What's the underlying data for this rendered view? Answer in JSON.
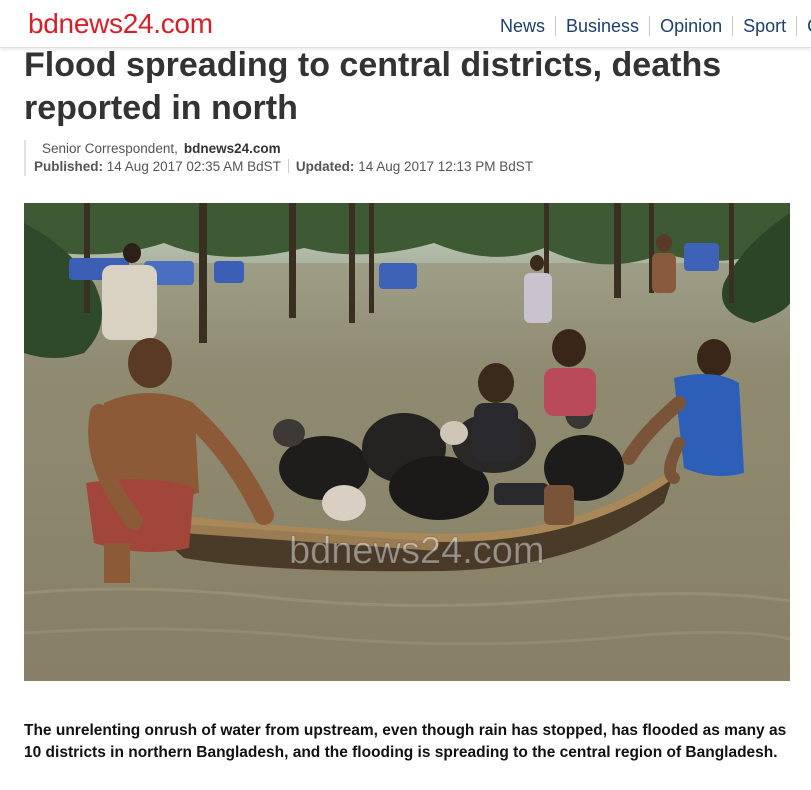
{
  "header": {
    "logo": "bdnews24.com",
    "nav": [
      "News",
      "Business",
      "Opinion",
      "Sport",
      "C"
    ]
  },
  "article": {
    "title": "Flood spreading to central districts, deaths reported in north",
    "author": "Senior Correspondent,",
    "author_site": "bdnews24.com",
    "published_label": "Published:",
    "published_value": "14 Aug 2017 02:35 AM BdST",
    "updated_label": "Updated:",
    "updated_value": "14 Aug 2017 12:13 PM BdST",
    "photo_watermark": "bdnews24.com",
    "lead": "The unrelenting onrush of water from upstream, even though rain has stopped, has flooded as many as 10 districts in northern Bangladesh, and the flooding is spreading to the central region of Bangladesh."
  },
  "colors": {
    "brand": "#d3202a",
    "nav_text": "#1d3f6b",
    "headline": "#333333",
    "water": "#8a8369"
  }
}
